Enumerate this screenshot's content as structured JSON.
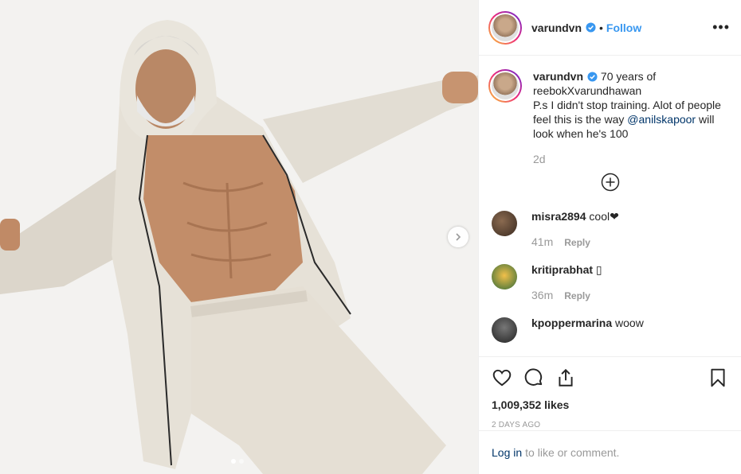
{
  "post": {
    "username": "varundvn",
    "follow_label": "Follow",
    "separator": "•",
    "more_label": "•••",
    "caption_line1": "70 years of",
    "caption_line2": "reebokXvarundhawan",
    "caption_line3": "P.s I didn't stop training. Alot of people feel this is the way",
    "caption_mention": "@anilskapoor",
    "caption_end": " will look when he's 100",
    "caption_time": "2d",
    "likes": "1,009,352 likes",
    "posted_ago": "2 DAYS AGO",
    "carousel": {
      "total": 2,
      "active": 1
    }
  },
  "comments": [
    {
      "username": "misra2894",
      "text": "cool❤",
      "time": "41m",
      "reply": "Reply",
      "avatar_color": "#4a3a30"
    },
    {
      "username": "kritiprabhat",
      "text": "▯",
      "time": "36m",
      "reply": "Reply",
      "avatar_color": "#e0a020"
    },
    {
      "username": "kpoppermarina",
      "text": "woow",
      "time": "",
      "reply": "",
      "avatar_color": "#333333"
    }
  ],
  "login_bar": {
    "login_label": "Log in",
    "rest": "to like or comment."
  },
  "icons": [
    "heart-icon",
    "comment-icon",
    "share-icon",
    "bookmark-icon",
    "chevron-right-icon",
    "plus-circle-icon",
    "verified-icon"
  ],
  "colors": {
    "link": "#3897f0",
    "mention": "#003569",
    "muted": "#999999",
    "border": "#efefef"
  }
}
